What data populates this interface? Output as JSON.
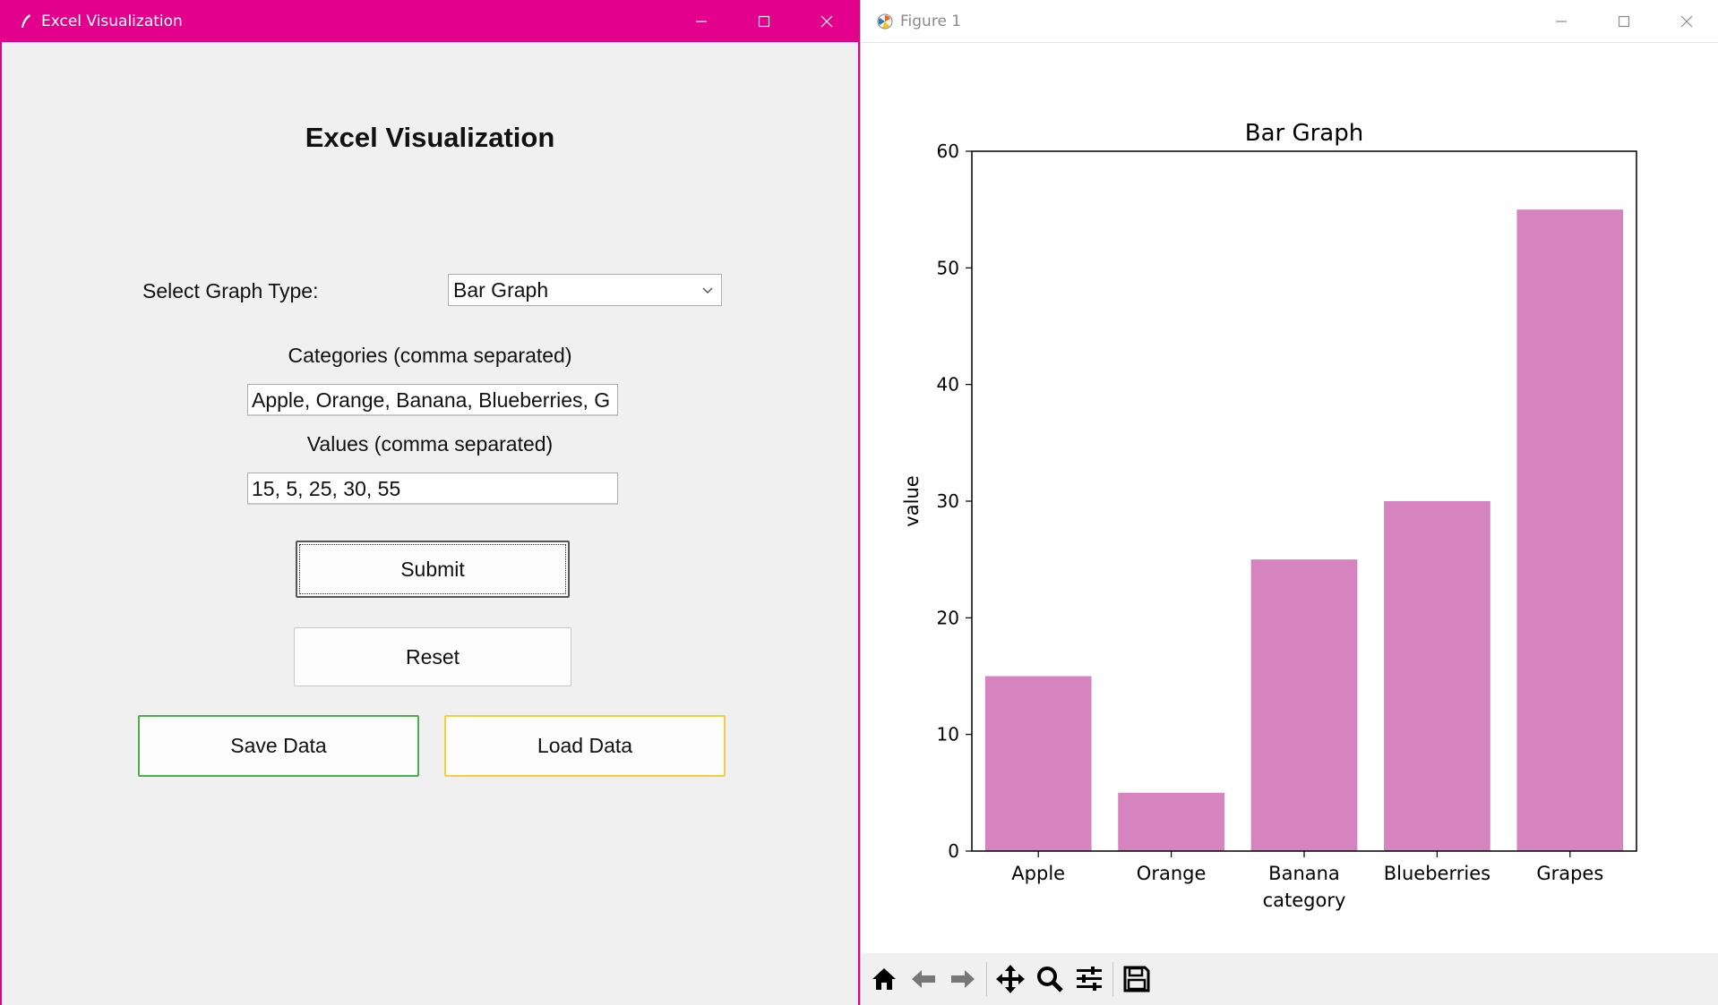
{
  "left_window": {
    "title": "Excel Visualization",
    "heading": "Excel Visualization",
    "graph_type_label": "Select Graph Type:",
    "graph_type_value": "Bar Graph",
    "categories_label": "Categories (comma separated)",
    "categories_value": "Apple, Orange, Banana, Blueberries, G",
    "values_label": "Values (comma separated)",
    "values_value": "15, 5, 25, 30, 55",
    "submit_label": "Submit",
    "reset_label": "Reset",
    "save_label": "Save Data",
    "load_label": "Load Data",
    "titlebar_color": "#e3008c"
  },
  "right_window": {
    "title": "Figure 1",
    "toolbar_icons": [
      "home-icon",
      "back-icon",
      "forward-icon",
      "pan-icon",
      "zoom-icon",
      "configure-subplots-icon",
      "save-figure-icon"
    ]
  },
  "chart_data": {
    "type": "bar",
    "title": "Bar Graph",
    "xlabel": "category",
    "ylabel": "value",
    "categories": [
      "Apple",
      "Orange",
      "Banana",
      "Blueberries",
      "Grapes"
    ],
    "values": [
      15,
      5,
      25,
      30,
      55
    ],
    "ylim": [
      0,
      60
    ],
    "yticks": [
      0,
      10,
      20,
      30,
      40,
      50,
      60
    ],
    "bar_color": "#d584bf",
    "grid": false,
    "legend": "none"
  }
}
